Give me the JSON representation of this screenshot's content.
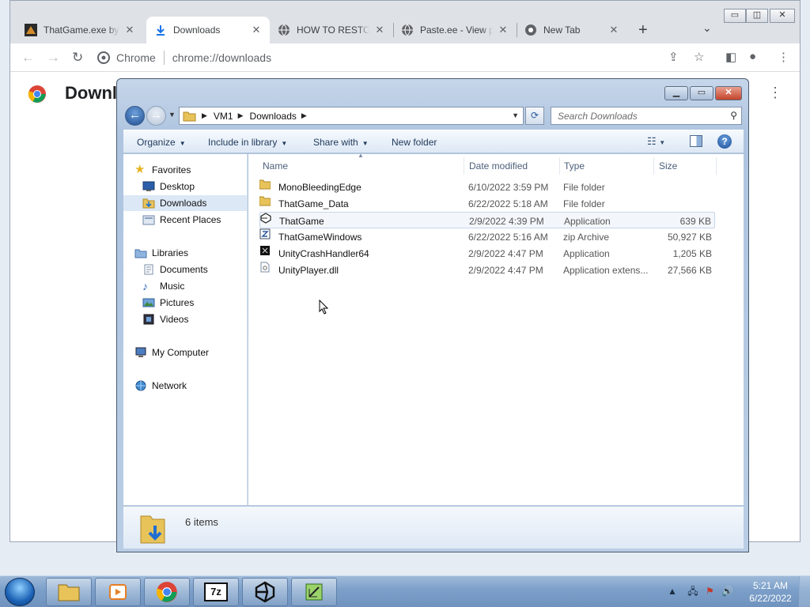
{
  "browser": {
    "tabs": [
      {
        "label": "ThatGame.exe by",
        "icon": "thatgame-favicon-icon"
      },
      {
        "label": "Downloads",
        "icon": "download-icon"
      },
      {
        "label": "HOW TO RESTOR",
        "icon": "globe-icon"
      },
      {
        "label": "Paste.ee - View p",
        "icon": "globe-icon"
      },
      {
        "label": "New Tab",
        "icon": "chrome-icon"
      }
    ],
    "new_tab": "+",
    "site_chip": "Chrome",
    "url": "chrome://downloads",
    "page_title": "Downlo"
  },
  "explorer": {
    "breadcrumb": [
      "VM1",
      "Downloads"
    ],
    "search_placeholder": "Search Downloads",
    "commands": {
      "organize": "Organize",
      "include_in_library": "Include in library",
      "share_with": "Share with",
      "new_folder": "New folder"
    },
    "nav": {
      "favorites": "Favorites",
      "desktop": "Desktop",
      "downloads": "Downloads",
      "recent_places": "Recent Places",
      "libraries": "Libraries",
      "documents": "Documents",
      "music": "Music",
      "pictures": "Pictures",
      "videos": "Videos",
      "my_computer": "My Computer",
      "network": "Network"
    },
    "columns": {
      "name": "Name",
      "date": "Date modified",
      "type": "Type",
      "size": "Size"
    },
    "files": [
      {
        "name": "MonoBleedingEdge",
        "date": "6/10/2022 3:59 PM",
        "type": "File folder",
        "size": ""
      },
      {
        "name": "ThatGame_Data",
        "date": "6/22/2022 5:18 AM",
        "type": "File folder",
        "size": ""
      },
      {
        "name": "ThatGame",
        "date": "2/9/2022 4:39 PM",
        "type": "Application",
        "size": "639 KB"
      },
      {
        "name": "ThatGameWindows",
        "date": "6/22/2022 5:16 AM",
        "type": "zip Archive",
        "size": "50,927 KB"
      },
      {
        "name": "UnityCrashHandler64",
        "date": "2/9/2022 4:47 PM",
        "type": "Application",
        "size": "1,205 KB"
      },
      {
        "name": "UnityPlayer.dll",
        "date": "2/9/2022 4:47 PM",
        "type": "Application extens...",
        "size": "27,566 KB"
      }
    ],
    "status": "6 items"
  },
  "taskbar": {
    "pinned": [
      "explorer-icon",
      "media-player-icon",
      "chrome-icon",
      "7zip-icon",
      "unity-icon",
      "editor-icon"
    ],
    "time": "5:21 AM",
    "date": "6/22/2022"
  }
}
